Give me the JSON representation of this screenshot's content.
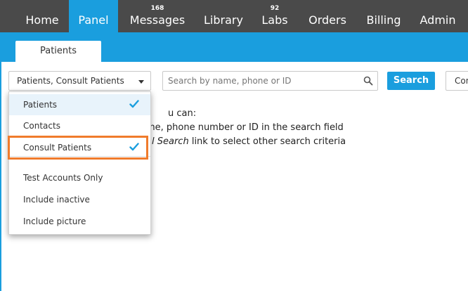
{
  "nav": {
    "items": [
      {
        "label": "Home",
        "count": ""
      },
      {
        "label": "Panel",
        "count": ""
      },
      {
        "label": "Messages",
        "count": "168"
      },
      {
        "label": "Library",
        "count": ""
      },
      {
        "label": "Labs",
        "count": "92"
      },
      {
        "label": "Orders",
        "count": ""
      },
      {
        "label": "Billing",
        "count": ""
      },
      {
        "label": "Admin",
        "count": ""
      }
    ],
    "active": "Panel"
  },
  "subtabs": {
    "patients": "Patients"
  },
  "filter": {
    "selected": "Patients, Consult Patients",
    "options": [
      {
        "label": "Patients",
        "checked": true
      },
      {
        "label": "Contacts",
        "checked": false
      },
      {
        "label": "Consult Patients",
        "checked": true
      },
      {
        "label": "Test Accounts Only",
        "checked": false
      },
      {
        "label": "Include inactive",
        "checked": false
      },
      {
        "label": "Include picture",
        "checked": false
      }
    ]
  },
  "search": {
    "placeholder": "Search by name, phone or ID",
    "button_label": "Search",
    "next_button_label": "Con"
  },
  "instructions": {
    "line1": "u can:",
    "line2": "ame, phone number or ID in the search field",
    "line3_em": "l Search",
    "line3_rest": " link to select other search criteria"
  },
  "colors": {
    "nav_bg": "#4a4a4a",
    "accent": "#1a9ede",
    "highlight": "#f07b2c",
    "check": "#1a9ede"
  },
  "icons": {
    "search": "magnifier",
    "caret": "chevron-down",
    "check": "checkmark"
  }
}
